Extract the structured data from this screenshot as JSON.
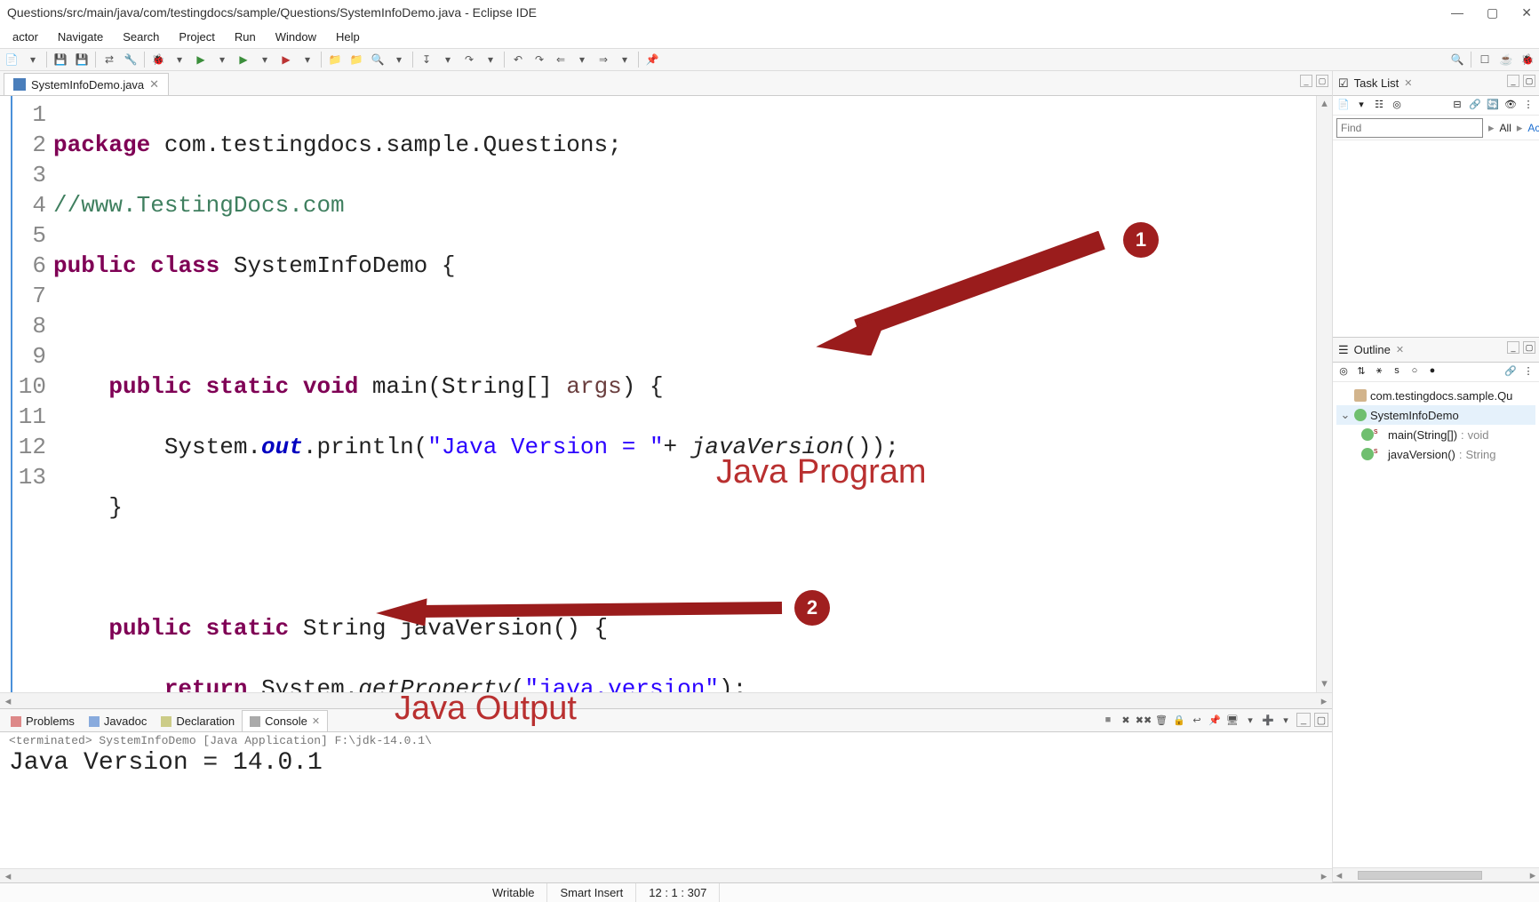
{
  "window": {
    "title": "Questions/src/main/java/com/testingdocs/sample/Questions/SystemInfoDemo.java - Eclipse IDE"
  },
  "menubar": [
    "actor",
    "Navigate",
    "Search",
    "Project",
    "Run",
    "Window",
    "Help"
  ],
  "editor": {
    "tab": {
      "filename": "SystemInfoDemo.java"
    },
    "lines": [
      "1",
      "2",
      "3",
      "4",
      "5",
      "6",
      "7",
      "8",
      "9",
      "10",
      "11",
      "12",
      "13"
    ],
    "code": {
      "l1_a": "package",
      "l1_b": " com.testingdocs.sample.Questions;",
      "l2": "//www.TestingDocs.com",
      "l3_a": "public",
      "l3_b": "class",
      "l3_c": " SystemInfoDemo {",
      "l5_a": "public",
      "l5_b": "static",
      "l5_c": "void",
      "l5_d": " main(String[] ",
      "l5_e": "args",
      "l5_f": ") {",
      "l6_a": "        System.",
      "l6_b": "out",
      "l6_c": ".println(",
      "l6_d": "\"Java Version = \"",
      "l6_e": "+ ",
      "l6_f": "javaVersion",
      "l6_g": "());",
      "l7": "    }",
      "l9_a": "public",
      "l9_b": "static",
      "l9_c": " String javaVersion() {",
      "l10_a": "return",
      "l10_b": " System.",
      "l10_c": "getProperty",
      "l10_d": "(",
      "l10_e": "\"java.version\"",
      "l10_f": ");",
      "l11": "    }",
      "l13": "}"
    }
  },
  "bottom": {
    "tabs": [
      "Problems",
      "Javadoc",
      "Declaration",
      "Console"
    ],
    "active_tab": "Console",
    "runinfo": "<terminated> SystemInfoDemo [Java Application] F:\\jdk-14.0.1\\",
    "output": "Java Version = 14.0.1"
  },
  "tasklist": {
    "title": "Task List",
    "find_placeholder": "Find",
    "filters": {
      "all": "All",
      "activate": "Activate..."
    }
  },
  "outline": {
    "title": "Outline",
    "package": "com.testingdocs.sample.Qu",
    "class": "SystemInfoDemo",
    "methods": [
      {
        "sig": "main(String[])",
        "ret": "void"
      },
      {
        "sig": "javaVersion()",
        "ret": "String"
      }
    ]
  },
  "statusbar": {
    "writable": "Writable",
    "insert": "Smart Insert",
    "pos": "12 : 1 : 307"
  },
  "annotations": {
    "badge1": "1",
    "badge2": "2",
    "label_program": "Java Program",
    "label_output": "Java Output"
  }
}
